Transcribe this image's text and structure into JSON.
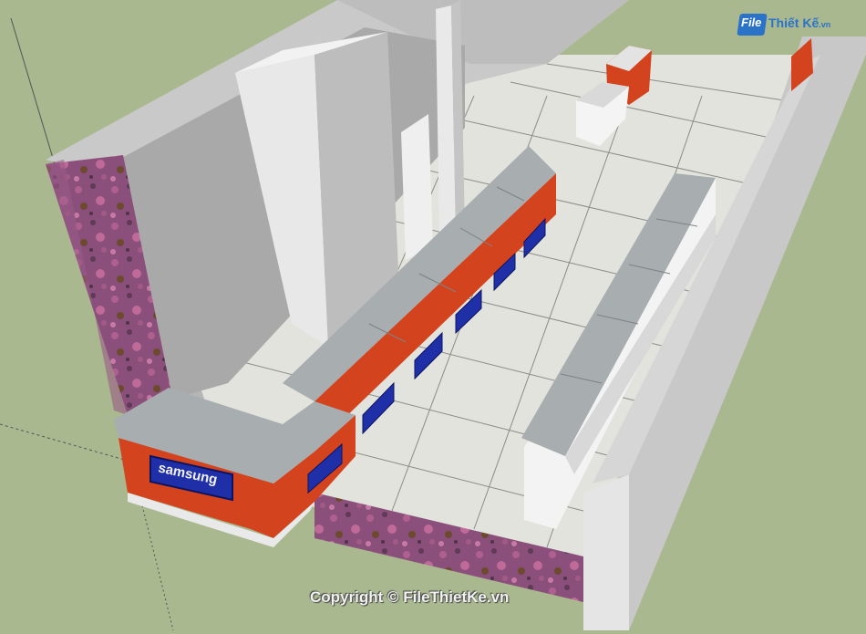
{
  "brand_sign": "samsung",
  "watermark": {
    "logo_file": "File",
    "logo_rest": "Thiết Kế",
    "logo_domain": ".vn",
    "copyright": "Copyright © FileThietKe.vn"
  },
  "colors": {
    "ground": "#a9b88f",
    "wall": "#c9c9c9",
    "floor": "#e3e3dd",
    "counter_red": "#d3431e",
    "sign_blue": "#1f2fa8",
    "glass": "#b8bcbf",
    "granite": "#8a4f7a"
  }
}
